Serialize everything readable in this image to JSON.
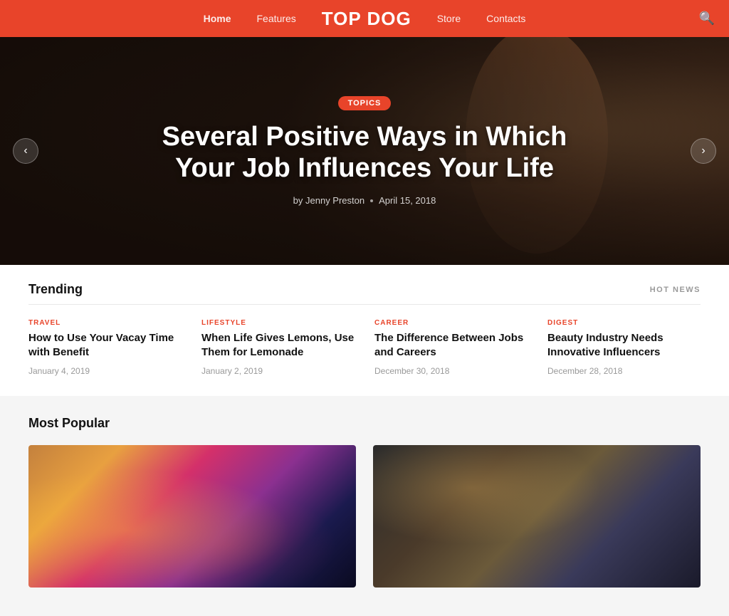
{
  "nav": {
    "brand": "TOP DOG",
    "links": [
      {
        "label": "Home",
        "active": true
      },
      {
        "label": "Features",
        "active": false
      },
      {
        "label": "Store",
        "active": false
      },
      {
        "label": "Contacts",
        "active": false
      }
    ],
    "search_icon": "🔍"
  },
  "hero": {
    "badge": "TOPICS",
    "title": "Several Positive Ways in Which Your Job Influences Your Life",
    "author": "by Jenny Preston",
    "date": "April 15, 2018",
    "arrow_left": "‹",
    "arrow_right": "›"
  },
  "trending": {
    "section_title": "Trending",
    "hot_news_label": "HOT NEWS",
    "items": [
      {
        "category": "TRAVEL",
        "category_class": "cat-travel",
        "title": "How to Use Your Vacay Time with Benefit",
        "date": "January 4, 2019"
      },
      {
        "category": "LIFESTYLE",
        "category_class": "cat-lifestyle",
        "title": "When Life Gives Lemons, Use Them for Lemonade",
        "date": "January 2, 2019"
      },
      {
        "category": "CAREER",
        "category_class": "cat-career",
        "title": "The Difference Between Jobs and Careers",
        "date": "December 30, 2018"
      },
      {
        "category": "DIGEST",
        "category_class": "cat-digest",
        "title": "Beauty Industry Needs Innovative Influencers",
        "date": "December 28, 2018"
      }
    ]
  },
  "popular": {
    "section_title": "Most Popular",
    "cards": [
      {
        "id": "nightmarket",
        "alt": "Night market street scene"
      },
      {
        "id": "office",
        "alt": "Office team meeting"
      }
    ]
  }
}
